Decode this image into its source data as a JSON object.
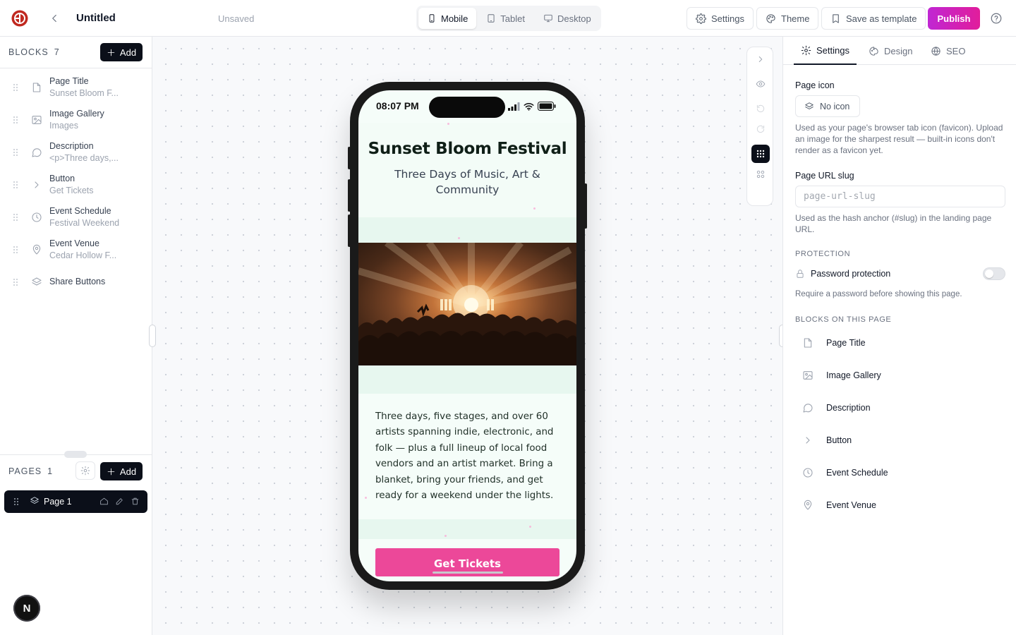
{
  "topbar": {
    "title": "Untitled",
    "status": "Unsaved",
    "devices": [
      {
        "label": "Mobile",
        "active": true
      },
      {
        "label": "Tablet"
      },
      {
        "label": "Desktop"
      }
    ],
    "settings_label": "Settings",
    "theme_label": "Theme",
    "save_template_label": "Save as template",
    "publish_label": "Publish",
    "publish_color": "#d81bc0"
  },
  "blocks_panel": {
    "heading": "Blocks",
    "count": "7",
    "add_label": "Add",
    "items": [
      {
        "name": "Page Title",
        "sub": "Sunset Bloom F...",
        "icon": "page-title-icon"
      },
      {
        "name": "Image Gallery",
        "sub": "Images",
        "icon": "image-icon"
      },
      {
        "name": "Description",
        "sub": "<p>Three days,...",
        "icon": "message-circle-icon"
      },
      {
        "name": "Button",
        "sub": "Get Tickets",
        "icon": "chevron-right-icon"
      },
      {
        "name": "Event Schedule",
        "sub": "Festival Weekend",
        "icon": "clock-icon"
      },
      {
        "name": "Event Venue",
        "sub": "Cedar Hollow F...",
        "icon": "map-pin-icon"
      },
      {
        "name": "Share Buttons",
        "sub": "",
        "icon": "layers-icon"
      }
    ]
  },
  "pages_panel": {
    "heading": "Pages",
    "count": "1",
    "add_label": "Add",
    "pages": [
      {
        "name": "Page 1",
        "selected": true
      }
    ]
  },
  "avatar_letter": "N",
  "preview": {
    "time": "08:07 PM",
    "title": "Sunset Bloom Festival",
    "subtitle": "Three Days of Music, Art & Community",
    "description": "Three days, five stages, and over 60 artists spanning indie, electronic, and folk — plus a full lineup of local food vendors and an artist market. Bring a blanket, bring your friends, and get ready for a weekend under the lights.",
    "cta_label": "Get Tickets",
    "accent": "#ec4899",
    "background": "#f5fdf9"
  },
  "settings_panel": {
    "tabs": [
      {
        "label": "Settings",
        "active": true
      },
      {
        "label": "Design"
      },
      {
        "label": "SEO"
      }
    ],
    "page_icon_label": "Page icon",
    "no_icon_label": "No icon",
    "page_icon_help": "Used as your page's browser tab icon (favicon). Upload an image for the sharpest result — built-in icons don't render as a favicon yet.",
    "slug_label": "Page URL slug",
    "slug_placeholder": "page-url-slug",
    "slug_help": "Used as the hash anchor (#slug) in the landing page URL.",
    "protection_heading": "Protection",
    "password_label": "Password protection",
    "password_enabled": false,
    "password_help": "Require a password before showing this page.",
    "blocks_heading": "Blocks on this page",
    "blocks": [
      "Page Title",
      "Image Gallery",
      "Description",
      "Button",
      "Event Schedule",
      "Event Venue"
    ]
  }
}
